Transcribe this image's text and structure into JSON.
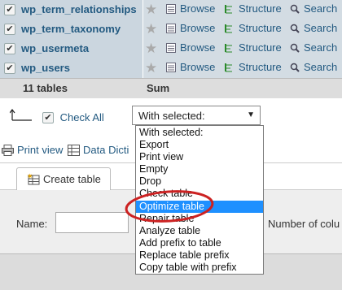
{
  "tables": [
    {
      "name": "wp_term_relationships",
      "browse": "Browse",
      "structure": "Structure",
      "search": "Search"
    },
    {
      "name": "wp_term_taxonomy",
      "browse": "Browse",
      "structure": "Structure",
      "search": "Search"
    },
    {
      "name": "wp_usermeta",
      "browse": "Browse",
      "structure": "Structure",
      "search": "Search"
    },
    {
      "name": "wp_users",
      "browse": "Browse",
      "structure": "Structure",
      "search": "Search"
    }
  ],
  "footer": {
    "count": "11 tables",
    "sum": "Sum"
  },
  "check_all": {
    "label": "Check All",
    "checked": true
  },
  "with_selected": {
    "value": "With selected:",
    "options": [
      "With selected:",
      "Export",
      "Print view",
      "Empty",
      "Drop",
      "Check table",
      "Optimize table",
      "Repair table",
      "Analyze table",
      "Add prefix to table",
      "Replace table prefix",
      "Copy table with prefix"
    ],
    "highlighted": "Optimize table"
  },
  "links": {
    "print_view": "Print view",
    "data_dictionary": "Data Dicti"
  },
  "create_table": {
    "tab_label": "Create table",
    "name_label": "Name:",
    "num_columns_label": "Number of colu"
  },
  "colors": {
    "row_left": "#d3dce3",
    "row_right": "#d3dce3",
    "link": "#235a81",
    "highlight": "#1e90ff",
    "annotation": "#cc2222"
  }
}
